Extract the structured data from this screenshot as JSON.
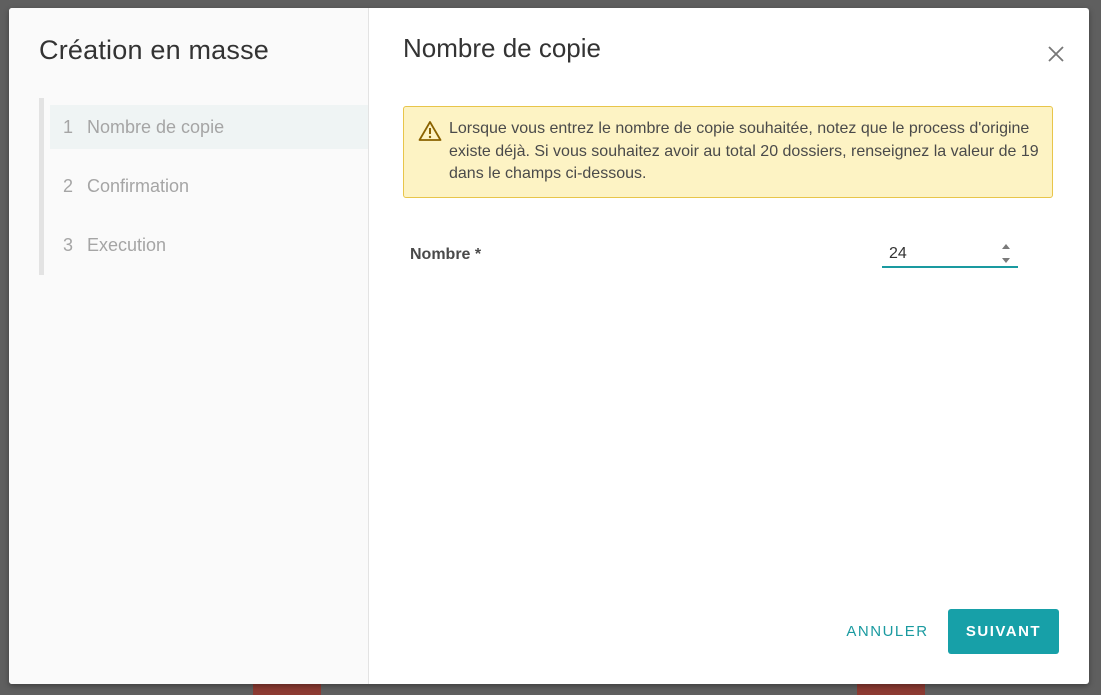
{
  "modal": {
    "sidebar": {
      "title": "Création en masse",
      "steps": [
        {
          "number": "1",
          "label": "Nombre de copie",
          "active": true
        },
        {
          "number": "2",
          "label": "Confirmation",
          "active": false
        },
        {
          "number": "3",
          "label": "Execution",
          "active": false
        }
      ]
    },
    "content": {
      "title": "Nombre de copie",
      "close_icon": "close-icon",
      "alert": {
        "icon": "warning-icon",
        "color": "#fdf3c4",
        "border_color": "#e8c54a",
        "text": "Lorsque vous entrez le nombre de copie souhaitée, notez que le process d'origine existe déjà. Si vous souhaitez avoir au total 20 dossiers, renseignez la valeur de 19 dans le champs ci-dessous."
      },
      "field": {
        "label": "Nombre *",
        "value": "24"
      }
    },
    "footer": {
      "cancel_label": "ANNULER",
      "next_label": "SUIVANT"
    }
  },
  "colors": {
    "accent": "#17a0a8",
    "backdrop": "#5f5f5f"
  }
}
